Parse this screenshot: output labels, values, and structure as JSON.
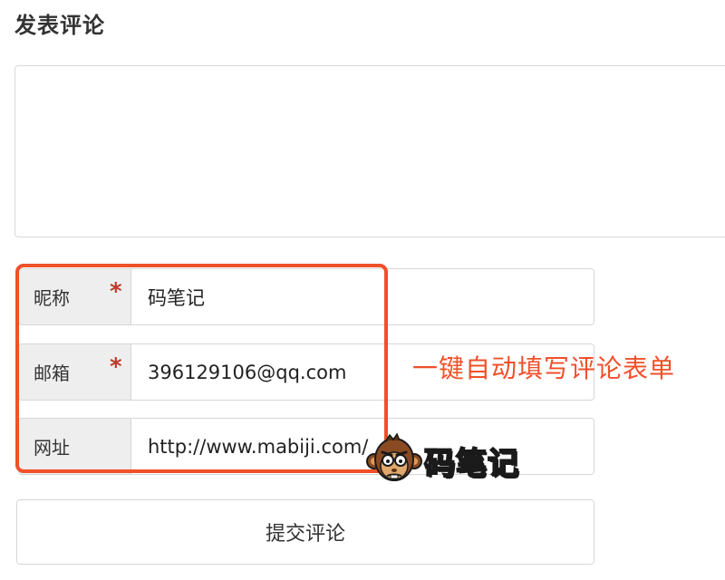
{
  "form": {
    "heading": "发表评论",
    "comment": {
      "value": "",
      "placeholder": ""
    },
    "nickname": {
      "label": "昵称",
      "required_mark": "*",
      "value": "码笔记"
    },
    "email": {
      "label": "邮箱",
      "required_mark": "*",
      "value": "396129106@qq.com"
    },
    "website": {
      "label": "网址",
      "value": "http://www.mabiji.com/"
    },
    "submit_label": "提交评论"
  },
  "annotation": {
    "text": "一键自动填写评论表单",
    "color": "#f0502a"
  },
  "brand": {
    "logo_icon": "monkey-face-icon",
    "name": "码笔记"
  }
}
